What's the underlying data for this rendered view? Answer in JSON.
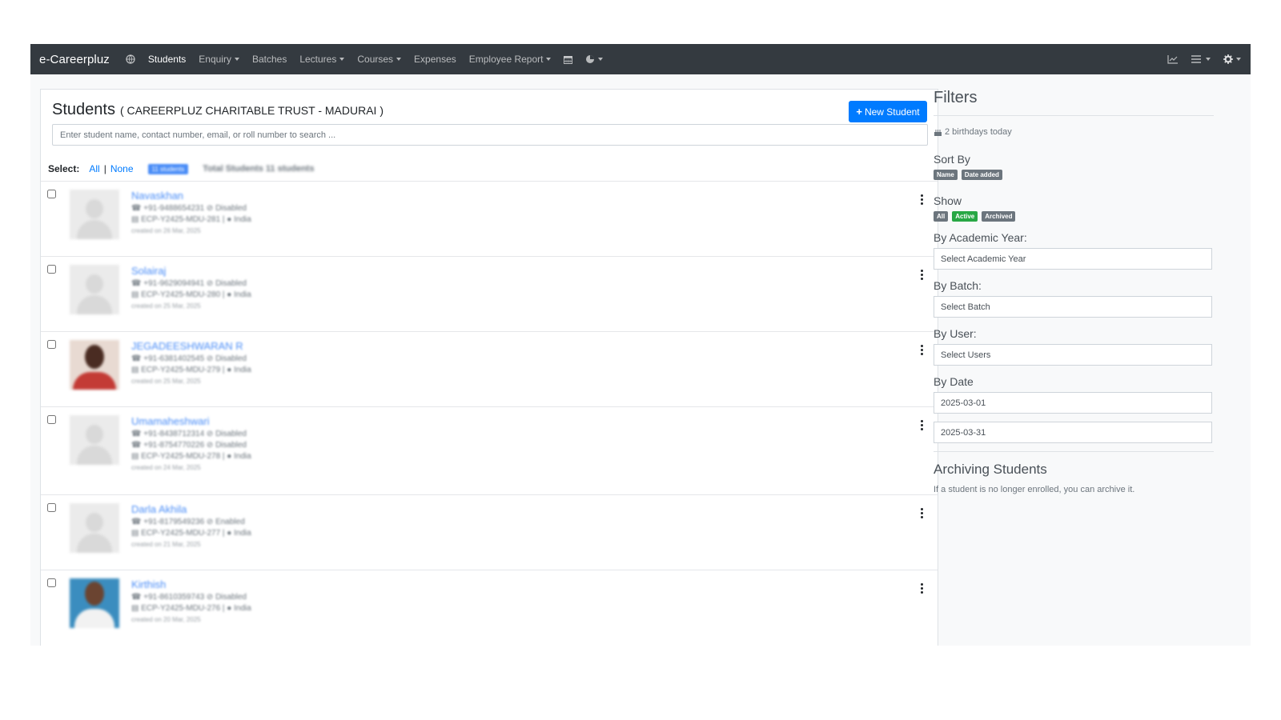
{
  "nav": {
    "brand": "e-Careerpluz",
    "items": [
      {
        "label": "Students",
        "active": true,
        "dropdown": false
      },
      {
        "label": "Enquiry",
        "dropdown": true
      },
      {
        "label": "Batches",
        "dropdown": false
      },
      {
        "label": "Lectures",
        "dropdown": true
      },
      {
        "label": "Courses",
        "dropdown": true
      },
      {
        "label": "Expenses",
        "dropdown": false
      },
      {
        "label": "Employee Report",
        "dropdown": true
      }
    ],
    "icons_left": [
      "globe-icon",
      "calendar-icon",
      "pie-chart-icon"
    ],
    "icons_right": [
      "chart-line-icon",
      "list-menu-icon",
      "gear-icon"
    ]
  },
  "main": {
    "title": "Students",
    "org": "( CAREERPLUZ CHARITABLE TRUST - MADURAI )",
    "new_button": "New Student",
    "search_placeholder": "Enter student name, contact number, email, or roll number to search ...",
    "select_label": "Select:",
    "select_all": "All",
    "select_none": "None",
    "count_badge": "11 students",
    "total_text": "Total Students 11 students"
  },
  "students": [
    {
      "name": "Navaskhan",
      "lines": [
        "☎ +91-9488654231 ⊘ Disabled",
        "▤ ECP-Y2425-MDU-281 | ● India"
      ],
      "created": "created on 26 Mar, 2025",
      "avatar": "placeholder"
    },
    {
      "name": "Solairaj",
      "lines": [
        "☎ +91-9629094941 ⊘ Disabled",
        "▤ ECP-Y2425-MDU-280 | ● India"
      ],
      "created": "created on 25 Mar, 2025",
      "avatar": "placeholder"
    },
    {
      "name": "JEGADEESHWARAN R",
      "lines": [
        "☎ +91-6381402545 ⊘ Disabled",
        "▤ ECP-Y2425-MDU-279 | ● India"
      ],
      "created": "created on 25 Mar, 2025",
      "avatar": "photo1"
    },
    {
      "name": "Umamaheshwari",
      "lines": [
        "☎ +91-8438712314 ⊘ Disabled",
        "☎ +91-8754770226 ⊘ Disabled",
        "▤ ECP-Y2425-MDU-278 | ● India"
      ],
      "created": "created on 24 Mar, 2025",
      "avatar": "placeholder"
    },
    {
      "name": "Darla Akhila",
      "lines": [
        "☎ +91-8179549236 ⊘ Enabled",
        "▤ ECP-Y2425-MDU-277 | ● India"
      ],
      "created": "created on 21 Mar, 2025",
      "avatar": "placeholder"
    },
    {
      "name": "Kirthish",
      "lines": [
        "☎ +91-8610359743 ⊘ Disabled",
        "▤ ECP-Y2425-MDU-276 | ● India"
      ],
      "created": "created on 20 Mar, 2025",
      "avatar": "photo2"
    }
  ],
  "filters": {
    "title": "Filters",
    "birthdays": "2 birthdays today",
    "sort_by": "Sort By",
    "sort_badges": [
      "Name",
      "Date added"
    ],
    "show": "Show",
    "show_badges": [
      {
        "label": "All",
        "color": "#6c757d"
      },
      {
        "label": "Active",
        "color": "#28a745"
      },
      {
        "label": "Archived",
        "color": "#6c757d"
      }
    ],
    "academic_year_label": "By Academic Year:",
    "academic_year_value": "Select Academic Year",
    "batch_label": "By Batch:",
    "batch_value": "Select Batch",
    "user_label": "By User:",
    "user_value": "Select Users",
    "date_label": "By Date",
    "date_from": "2025-03-01",
    "date_to": "2025-03-31",
    "archive_title": "Archiving Students",
    "archive_text": "If a student is no longer enrolled, you can archive it."
  },
  "colors": {
    "navbar": "#343a40",
    "primary": "#007bff",
    "success": "#28a745",
    "secondary": "#6c757d"
  }
}
